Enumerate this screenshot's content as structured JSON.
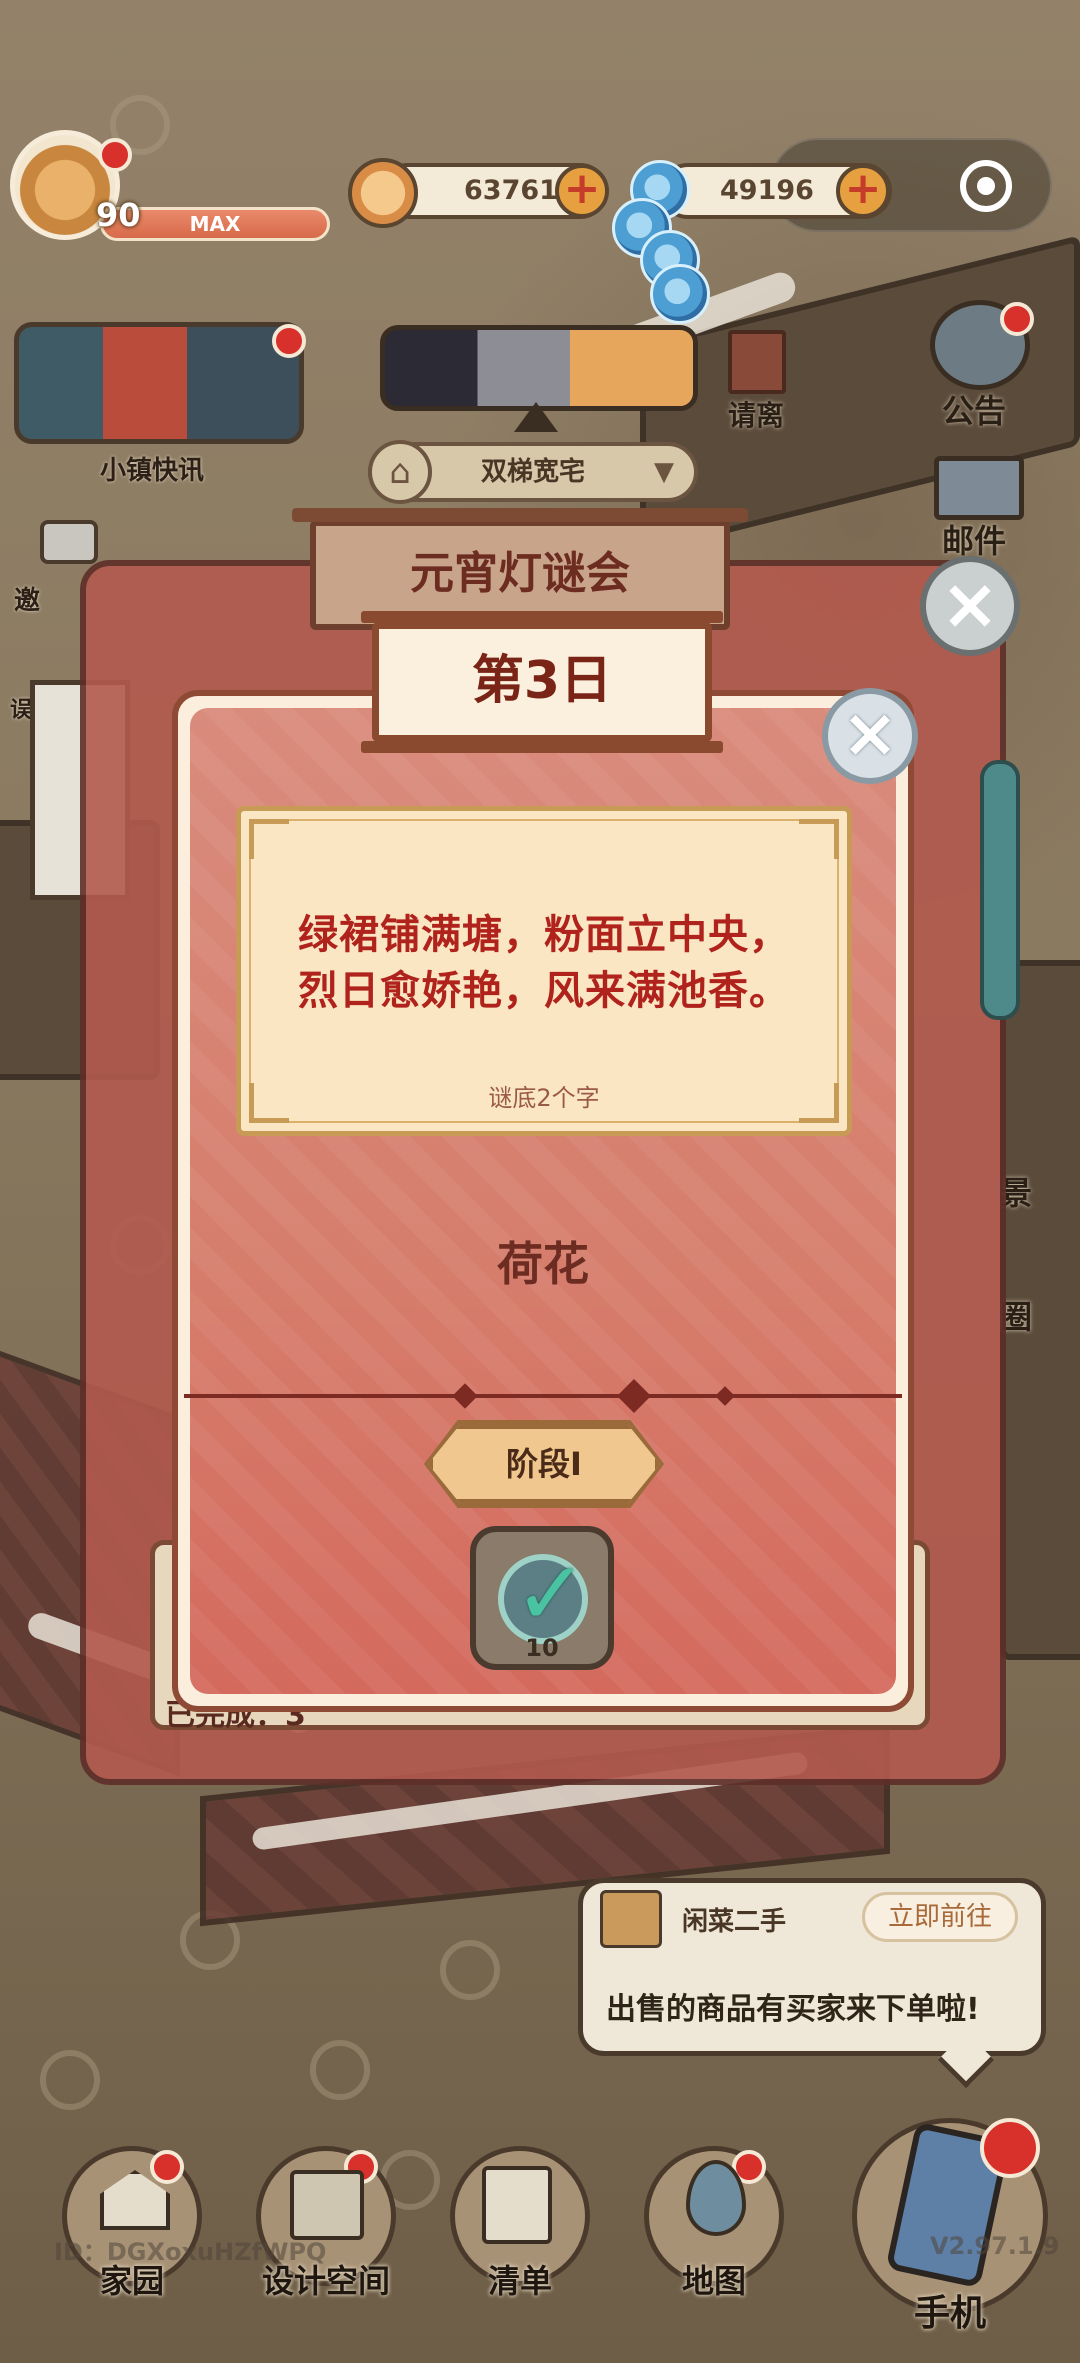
{
  "hud": {
    "level": "90",
    "level_status": "MAX",
    "coins": "637619",
    "gems": "49196"
  },
  "left_panel": {
    "news_label": "小镇快讯",
    "invite_label_partial": "邀",
    "side_label_partial": "误"
  },
  "center_panel": {
    "house_name": "双梯宽宅"
  },
  "right_panel": {
    "leave_label": "请离",
    "notice_label": "公告",
    "mail_label": "邮件",
    "side_label_1": "景",
    "side_label_2": "圈"
  },
  "event": {
    "title": "元宵灯谜会",
    "day": "第3日",
    "riddle_line_1": "绿裙铺满塘，粉面立中央，",
    "riddle_line_2": "烈日愈娇艳，风来满池香。",
    "riddle_hint": "谜底2个字",
    "answer": "荷花",
    "stage": "阶段I",
    "behind_count": "10",
    "behind_completed": "已完成：3"
  },
  "toast": {
    "title": "闲菜二手",
    "action": "立即前往",
    "message": "出售的商品有买家来下单啦!"
  },
  "bottom_nav": {
    "home": "家园",
    "design": "设计空间",
    "list": "清单",
    "map": "地图",
    "phone": "手机"
  },
  "footer": {
    "id": "ID：DGXoxuHZfWPQ",
    "version": "V2.97.1.9"
  },
  "colors": {
    "panel_red": "#d67e6d",
    "riddle_text": "#b0221c",
    "accent_gold": "#f0c78e",
    "check_green": "#49c3a1"
  }
}
